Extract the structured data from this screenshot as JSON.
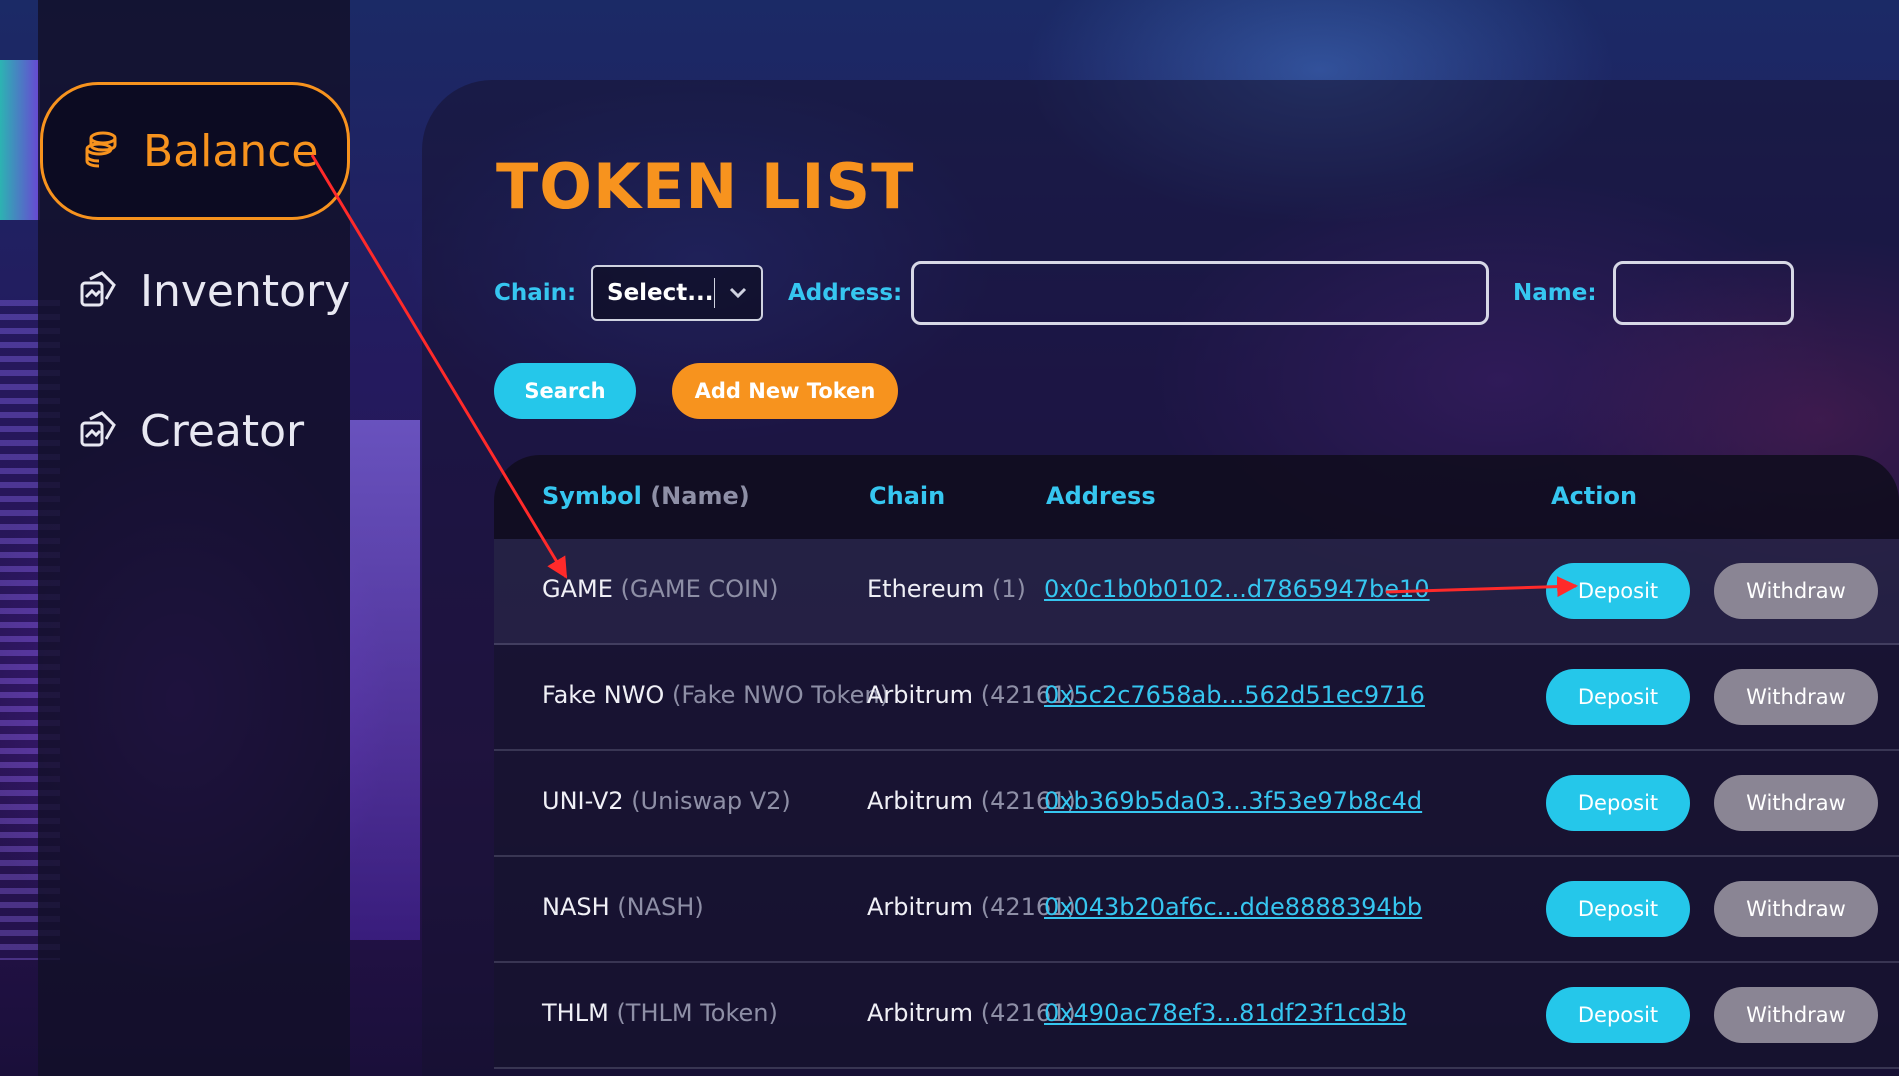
{
  "sidebar": {
    "items": [
      {
        "label": "Balance",
        "icon": "coins-icon",
        "active": true
      },
      {
        "label": "Inventory",
        "icon": "cards-icon",
        "active": false
      },
      {
        "label": "Creator",
        "icon": "cards-icon",
        "active": false
      }
    ]
  },
  "page": {
    "title": "TOKEN LIST"
  },
  "filters": {
    "chain_label": "Chain:",
    "chain_value": "Select...",
    "address_label": "Address:",
    "address_value": "",
    "name_label": "Name:",
    "name_value": ""
  },
  "actions": {
    "search_label": "Search",
    "add_label": "Add New Token"
  },
  "table": {
    "headers": {
      "symbol": "Symbol",
      "symbol_sub": "(Name)",
      "chain": "Chain",
      "address": "Address",
      "action": "Action"
    },
    "rows": [
      {
        "symbol": "GAME",
        "name": "(GAME COIN)",
        "chain": "Ethereum",
        "chain_id": "(1)",
        "address": "0x0c1b0b0102...d7865947be10",
        "deposit": "Deposit",
        "withdraw": "Withdraw"
      },
      {
        "symbol": "Fake NWO",
        "name": "(Fake NWO Token)",
        "chain": "Arbitrum",
        "chain_id": "(42161)",
        "address": "0x5c2c7658ab...562d51ec9716",
        "deposit": "Deposit",
        "withdraw": "Withdraw"
      },
      {
        "symbol": "UNI-V2",
        "name": "(Uniswap V2)",
        "chain": "Arbitrum",
        "chain_id": "(42161)",
        "address": "0xb369b5da03...3f53e97b8c4d",
        "deposit": "Deposit",
        "withdraw": "Withdraw"
      },
      {
        "symbol": "NASH",
        "name": "(NASH)",
        "chain": "Arbitrum",
        "chain_id": "(42161)",
        "address": "0x043b20af6c...dde8888394bb",
        "deposit": "Deposit",
        "withdraw": "Withdraw"
      },
      {
        "symbol": "THLM",
        "name": "(THLM Token)",
        "chain": "Arbitrum",
        "chain_id": "(42161)",
        "address": "0x490ac78ef3...81df23f1cd3b",
        "deposit": "Deposit",
        "withdraw": "Withdraw"
      }
    ]
  },
  "colors": {
    "accent": "#f7931e",
    "cyan": "#25c7ea",
    "muted": "#8e8fa6",
    "annotation": "#ff2a2a"
  }
}
